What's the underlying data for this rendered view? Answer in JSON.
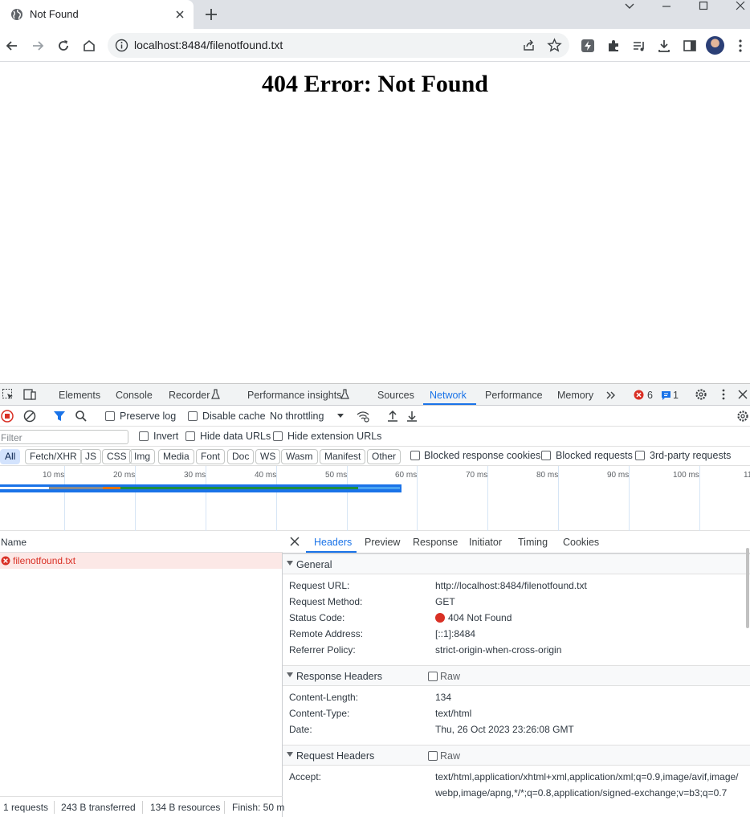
{
  "browser": {
    "tab_title": "Not Found",
    "url": "localhost:8484/filenotfound.txt"
  },
  "page": {
    "heading": "404 Error: Not Found"
  },
  "devtools": {
    "tabs": [
      "Elements",
      "Console",
      "Recorder",
      "Performance insights",
      "Sources",
      "Network",
      "Performance",
      "Memory"
    ],
    "active_tab": "Network",
    "error_count": "6",
    "message_count": "1",
    "toolbar": {
      "preserve_log": "Preserve log",
      "disable_cache": "Disable cache",
      "throttling": "No throttling"
    },
    "filter": {
      "placeholder": "Filter",
      "invert": "Invert",
      "hide_data_urls": "Hide data URLs",
      "hide_extension_urls": "Hide extension URLs"
    },
    "type_filters": [
      "All",
      "Fetch/XHR",
      "JS",
      "CSS",
      "Img",
      "Media",
      "Font",
      "Doc",
      "WS",
      "Wasm",
      "Manifest",
      "Other"
    ],
    "extra_filters": {
      "blocked_response_cookies": "Blocked response cookies",
      "blocked_requests": "Blocked requests",
      "third_party": "3rd-party requests"
    },
    "timeline_ticks": [
      "10 ms",
      "20 ms",
      "30 ms",
      "40 ms",
      "50 ms",
      "60 ms",
      "70 ms",
      "80 ms",
      "90 ms",
      "100 ms",
      "11"
    ],
    "name_header": "Name",
    "requests": [
      "filenotfound.txt"
    ],
    "status_bar": {
      "requests": "1 requests",
      "transferred": "243 B transferred",
      "resources": "134 B resources",
      "finish": "Finish: 50 m"
    },
    "detail_tabs": [
      "Headers",
      "Preview",
      "Response",
      "Initiator",
      "Timing",
      "Cookies"
    ],
    "active_detail_tab": "Headers",
    "general": {
      "title": "General",
      "rows": [
        {
          "key": "Request URL:",
          "value": "http://localhost:8484/filenotfound.txt"
        },
        {
          "key": "Request Method:",
          "value": "GET"
        },
        {
          "key": "Status Code:",
          "value": "404 Not Found"
        },
        {
          "key": "Remote Address:",
          "value": "[::1]:8484"
        },
        {
          "key": "Referrer Policy:",
          "value": "strict-origin-when-cross-origin"
        }
      ]
    },
    "response_headers": {
      "title": "Response Headers",
      "raw": "Raw",
      "rows": [
        {
          "key": "Content-Length:",
          "value": "134"
        },
        {
          "key": "Content-Type:",
          "value": "text/html"
        },
        {
          "key": "Date:",
          "value": "Thu, 26 Oct 2023 23:26:08 GMT"
        }
      ]
    },
    "request_headers": {
      "title": "Request Headers",
      "raw": "Raw",
      "rows": [
        {
          "key": "Accept:",
          "value": "text/html,application/xhtml+xml,application/xml;q=0.9,image/avif,image/webp,image/apng,*/*;q=0.8,application/signed-exchange;v=b3;q=0.7"
        }
      ]
    },
    "colors": {
      "accent": "#1a73e8",
      "error": "#d93025",
      "error_row": "#fce8e6"
    }
  }
}
